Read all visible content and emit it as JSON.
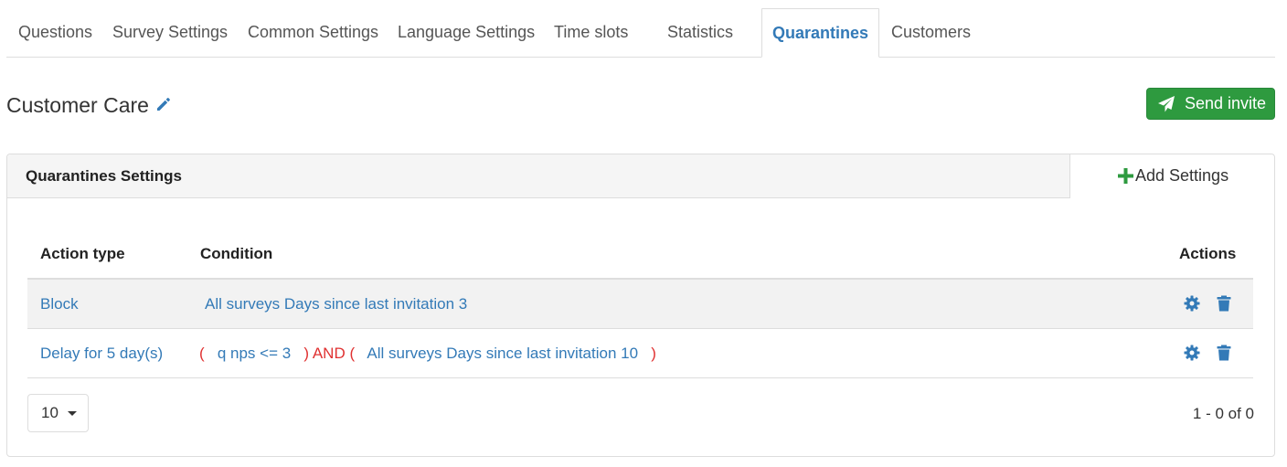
{
  "tabs": [
    {
      "label": "Questions",
      "active": false
    },
    {
      "label": "Survey Settings",
      "active": false
    },
    {
      "label": "Common Settings",
      "active": false
    },
    {
      "label": "Language Settings",
      "active": false
    },
    {
      "label": "Time slots",
      "active": false
    },
    {
      "label": "Statistics",
      "active": false
    },
    {
      "label": "Quarantines",
      "active": true
    },
    {
      "label": "Customers",
      "active": false
    }
  ],
  "header": {
    "title": "Customer Care",
    "edit_icon": "pencil-icon",
    "send_button_label": "Send invite",
    "send_icon": "paper-plane-icon"
  },
  "panel": {
    "title": "Quarantines Settings",
    "add_button_label": "Add Settings",
    "add_icon": "plus-icon"
  },
  "table": {
    "columns": {
      "action_type": "Action type",
      "condition": "Condition",
      "actions": "Actions"
    },
    "rows": [
      {
        "action_type": "Block",
        "condition": "All surveys Days since last invitation 3"
      },
      {
        "action_type": "Delay for 5 day(s)",
        "condition_open1": "(",
        "condition_part1": "q nps <= 3",
        "condition_close1": ")",
        "condition_operator": "AND",
        "condition_open2": "(",
        "condition_part2": "All surveys Days since last invitation 10",
        "condition_close2": ")"
      }
    ]
  },
  "footer": {
    "page_size": "10",
    "range_text": "1 - 0 of 0"
  },
  "colors": {
    "link": "#337ab7",
    "success": "#2e9a3f",
    "operator": "#e03131",
    "border": "#dddddd"
  }
}
